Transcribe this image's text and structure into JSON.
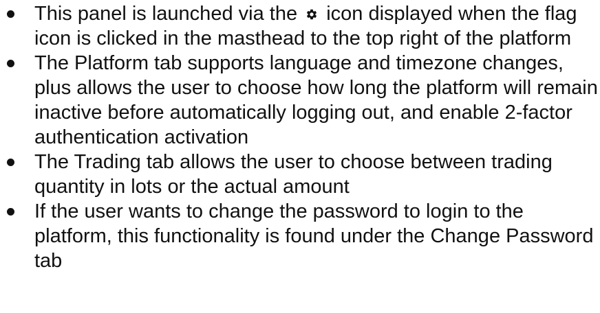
{
  "bullets": [
    {
      "part1": "This panel is launched via the",
      "icon": "gear-icon",
      "part2": "icon displayed when the flag icon is clicked in the masthead to the top right of the platform"
    },
    {
      "text": "The Platform tab supports language and timezone changes, plus allows the user to choose how long the platform will remain inactive before automatically logging out, and enable 2-factor authentication activation"
    },
    {
      "text": "The Trading tab allows the user to choose between trading quantity in lots or the actual amount"
    },
    {
      "text": "If the user wants to change the password to login to the platform, this functionality is found under the Change Password tab"
    }
  ]
}
